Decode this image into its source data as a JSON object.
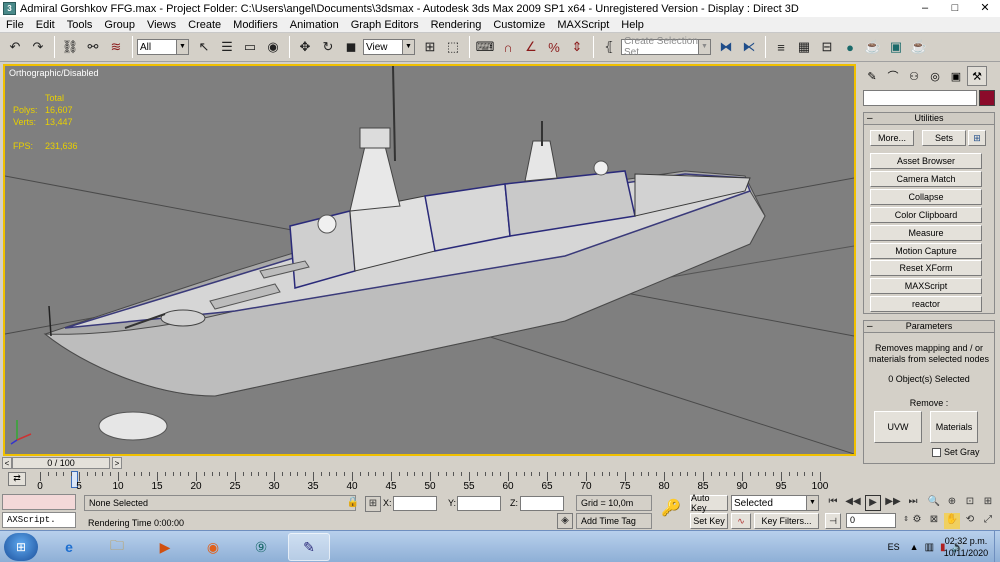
{
  "window": {
    "title": "Admiral Gorshkov FFG.max    - Project Folder: C:\\Users\\angel\\Documents\\3dsmax    - Autodesk 3ds Max  2009 SP1  x64   - Unregistered Version     - Display : Direct 3D",
    "buttons": [
      "–",
      "□",
      "✕"
    ]
  },
  "menu": [
    "File",
    "Edit",
    "Tools",
    "Group",
    "Views",
    "Create",
    "Modifiers",
    "Animation",
    "Graph Editors",
    "Rendering",
    "Customize",
    "MAXScript",
    "Help"
  ],
  "toolbar": {
    "selection_filter": "All",
    "ref_coord": "View",
    "named_selection_placeholder": "Create Selection Set"
  },
  "viewport": {
    "label": "Orthographic/Disabled",
    "stats": {
      "header": "Total",
      "polys_label": "Polys:",
      "polys": "16,607",
      "verts_label": "Verts:",
      "verts": "13,447",
      "fps_label": "FPS:",
      "fps": "231,636"
    },
    "model": "ship"
  },
  "command_panel": {
    "utilities": {
      "title": "Utilities",
      "more": "More...",
      "sets": "Sets",
      "items": [
        "Asset Browser",
        "Camera Match",
        "Collapse",
        "Color Clipboard",
        "Measure",
        "Motion Capture",
        "Reset XForm",
        "MAXScript",
        "reactor"
      ]
    },
    "parameters": {
      "title": "Parameters",
      "description": "Removes mapping and / or materials from selected nodes",
      "selected": "0 Object(s) Selected",
      "remove_label": "Remove :",
      "uvw": "UVW",
      "materials": "Materials",
      "set_gray": "Set Gray"
    },
    "swatch_color": "#8b0a2a"
  },
  "timeline": {
    "slider": "0 / 100",
    "ticks": [
      "0",
      "5",
      "10",
      "15",
      "20",
      "25",
      "30",
      "35",
      "40",
      "45",
      "50",
      "55",
      "60",
      "65",
      "70",
      "75",
      "80",
      "85",
      "90",
      "95",
      "100"
    ]
  },
  "status": {
    "maxscript": "AXScript.",
    "selection": "None Selected",
    "rendering_time": "Rendering Time  0:00:00",
    "x_label": "X:",
    "y_label": "Y:",
    "z_label": "Z:",
    "grid": "Grid = 10,0m",
    "add_time_tag": "Add Time Tag",
    "auto_key": "Auto Key",
    "set_key": "Set Key",
    "selected_mode": "Selected",
    "key_filters": "Key Filters...",
    "frame": "0"
  },
  "taskbar": {
    "language": "ES",
    "time": "02:32 p.m.",
    "date": "10/11/2020"
  }
}
